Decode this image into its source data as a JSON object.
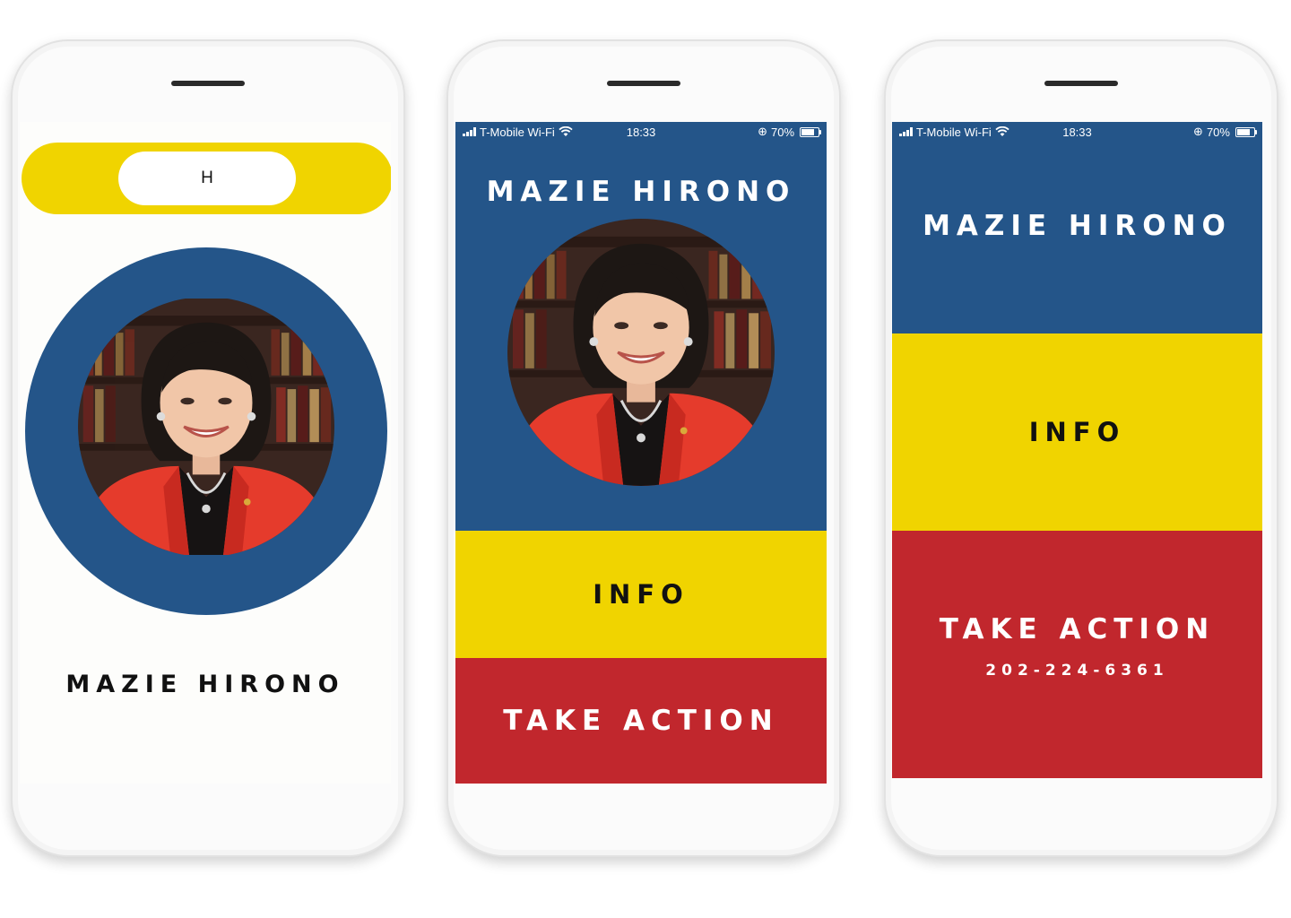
{
  "colors": {
    "blue": "#245589",
    "yellow": "#f0d400",
    "red": "#c1272d",
    "white": "#ffffff",
    "black": "#111111"
  },
  "status_bar": {
    "carrier": "T-Mobile Wi-Fi",
    "time": "18:33",
    "battery": "70%",
    "battery_level": 0.7,
    "icons": [
      "signal-icon",
      "wifi-icon",
      "orientation-lock-icon",
      "battery-icon"
    ]
  },
  "phone1": {
    "search_pill_text": "H",
    "name": "MAZIE HIRONO"
  },
  "phone2": {
    "name": "MAZIE HIRONO",
    "info_label": "INFO",
    "action_label": "TAKE ACTION"
  },
  "phone3": {
    "name": "MAZIE HIRONO",
    "info_label": "INFO",
    "action_label": "TAKE ACTION",
    "phone_number": "202-224-6361"
  }
}
